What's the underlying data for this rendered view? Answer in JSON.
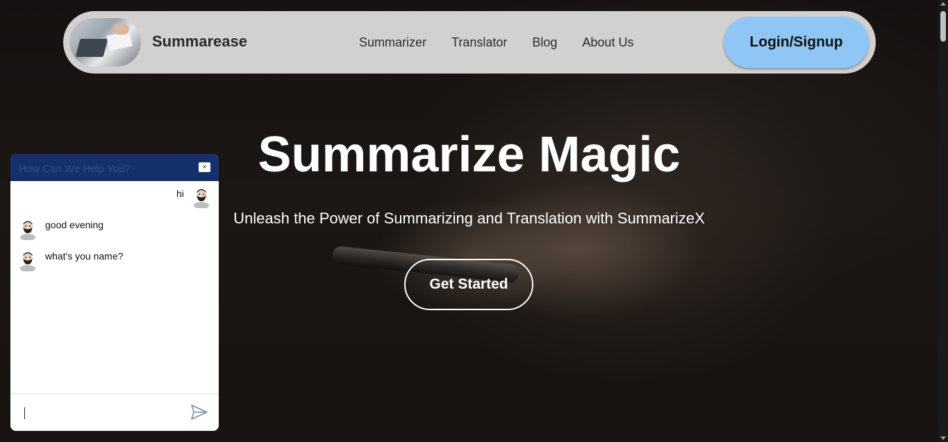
{
  "navbar": {
    "brand": "Summarease",
    "links": [
      "Summarizer",
      "Translator",
      "Blog",
      "About Us"
    ],
    "login_label": "Login/Signup"
  },
  "hero": {
    "title": "Summarize Magic",
    "subtitle": "Unleash the Power of Summarizing and Translation with SummarizeX",
    "cta_label": "Get Started"
  },
  "chat": {
    "header_placeholder": "How Can We Help You?",
    "close_label": "×",
    "messages": [
      {
        "from": "user",
        "text": "hi"
      },
      {
        "from": "bot",
        "text": "good evening"
      },
      {
        "from": "bot",
        "text": "what's you name?"
      }
    ],
    "input_value": ""
  },
  "colors": {
    "navbar_bg": "#d3d1cf",
    "login_bg": "#8fc6f5",
    "chat_header_bg": "#16306b"
  }
}
